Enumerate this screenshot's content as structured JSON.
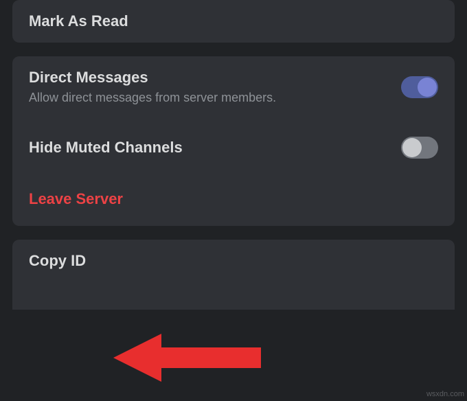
{
  "section1": {
    "markAsRead": "Mark As Read"
  },
  "section2": {
    "directMessages": {
      "title": "Direct Messages",
      "subtitle": "Allow direct messages from server members.",
      "enabled": true
    },
    "hideMutedChannels": {
      "title": "Hide Muted Channels",
      "enabled": false
    },
    "leaveServer": "Leave Server"
  },
  "section3": {
    "copyId": "Copy ID"
  },
  "watermark": "wsxdn.com"
}
